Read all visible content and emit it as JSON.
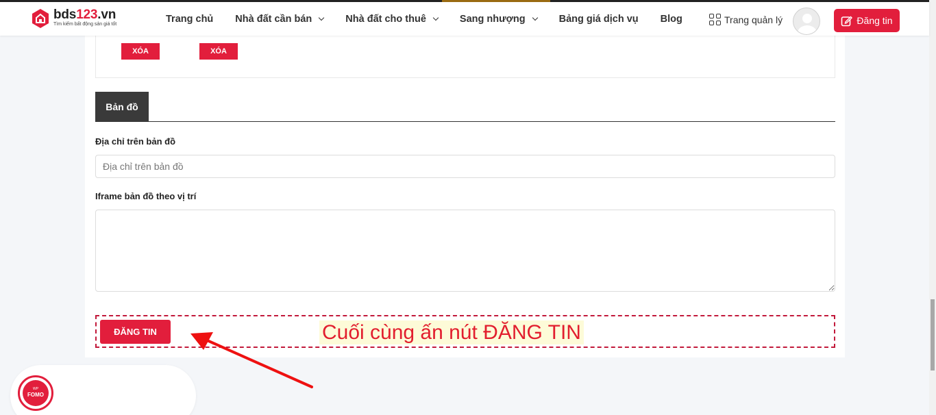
{
  "header": {
    "logo_main_prefix": "bds",
    "logo_main_red": "123",
    "logo_main_suffix": ".vn",
    "logo_tagline": "Tìm kiếm bất động sản giá tốt",
    "nav": [
      {
        "label": "Trang chủ"
      },
      {
        "label": "Nhà đất cần bán"
      },
      {
        "label": "Nhà đất cho thuê"
      },
      {
        "label": "Sang nhượng"
      },
      {
        "label": "Bảng giá dịch vụ"
      },
      {
        "label": "Blog"
      }
    ],
    "manage_label": "Trang quản lý",
    "post_label": "Đăng tin"
  },
  "images": {
    "delete_labels": [
      "XÓA",
      "XÓA"
    ]
  },
  "map_section": {
    "tab_label": "Bản đồ",
    "address_label": "Địa chỉ trên bản đồ",
    "address_placeholder": "Địa chỉ trên bản đồ",
    "address_value": "",
    "iframe_label": "Iframe bản đồ theo vị trí",
    "iframe_value": ""
  },
  "submit": {
    "label": "ĐĂNG TIN"
  },
  "annotation": {
    "text": "Cuối cùng ấn nút ĐĂNG TIN"
  },
  "widget": {
    "badge_line1": "WP",
    "badge_line2": "FOMO"
  },
  "colors": {
    "brand_red": "#e21e3c",
    "dark_tab": "#3a3a3a",
    "annotation_red": "#e21e2e"
  },
  "icons": {
    "logo": "house-icon",
    "manage": "grid-icon",
    "avatar": "user-avatar-icon",
    "post": "edit-icon",
    "arrow": "arrow-pointer-icon"
  }
}
